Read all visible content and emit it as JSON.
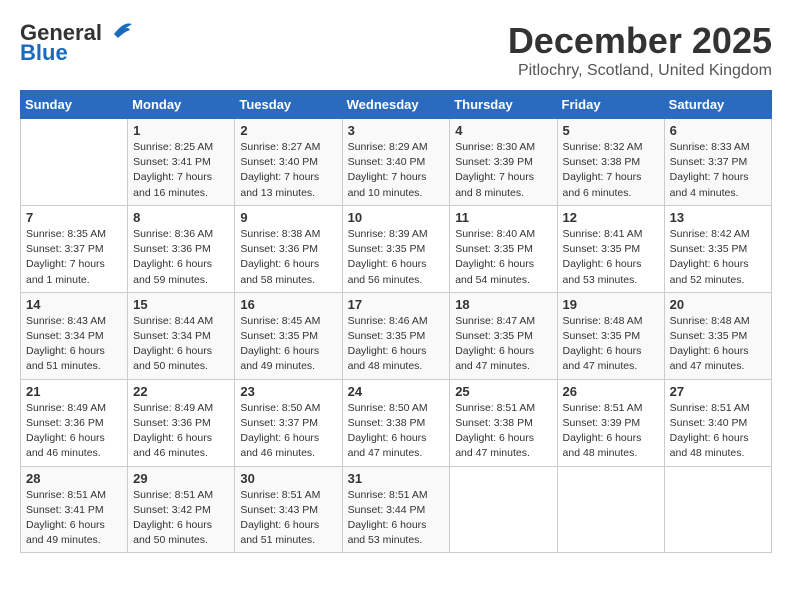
{
  "logo": {
    "general": "General",
    "blue": "Blue"
  },
  "title": "December 2025",
  "location": "Pitlochry, Scotland, United Kingdom",
  "days_of_week": [
    "Sunday",
    "Monday",
    "Tuesday",
    "Wednesday",
    "Thursday",
    "Friday",
    "Saturday"
  ],
  "weeks": [
    [
      {
        "day": "",
        "info": ""
      },
      {
        "day": "1",
        "info": "Sunrise: 8:25 AM\nSunset: 3:41 PM\nDaylight: 7 hours\nand 16 minutes."
      },
      {
        "day": "2",
        "info": "Sunrise: 8:27 AM\nSunset: 3:40 PM\nDaylight: 7 hours\nand 13 minutes."
      },
      {
        "day": "3",
        "info": "Sunrise: 8:29 AM\nSunset: 3:40 PM\nDaylight: 7 hours\nand 10 minutes."
      },
      {
        "day": "4",
        "info": "Sunrise: 8:30 AM\nSunset: 3:39 PM\nDaylight: 7 hours\nand 8 minutes."
      },
      {
        "day": "5",
        "info": "Sunrise: 8:32 AM\nSunset: 3:38 PM\nDaylight: 7 hours\nand 6 minutes."
      },
      {
        "day": "6",
        "info": "Sunrise: 8:33 AM\nSunset: 3:37 PM\nDaylight: 7 hours\nand 4 minutes."
      }
    ],
    [
      {
        "day": "7",
        "info": "Sunrise: 8:35 AM\nSunset: 3:37 PM\nDaylight: 7 hours\nand 1 minute."
      },
      {
        "day": "8",
        "info": "Sunrise: 8:36 AM\nSunset: 3:36 PM\nDaylight: 6 hours\nand 59 minutes."
      },
      {
        "day": "9",
        "info": "Sunrise: 8:38 AM\nSunset: 3:36 PM\nDaylight: 6 hours\nand 58 minutes."
      },
      {
        "day": "10",
        "info": "Sunrise: 8:39 AM\nSunset: 3:35 PM\nDaylight: 6 hours\nand 56 minutes."
      },
      {
        "day": "11",
        "info": "Sunrise: 8:40 AM\nSunset: 3:35 PM\nDaylight: 6 hours\nand 54 minutes."
      },
      {
        "day": "12",
        "info": "Sunrise: 8:41 AM\nSunset: 3:35 PM\nDaylight: 6 hours\nand 53 minutes."
      },
      {
        "day": "13",
        "info": "Sunrise: 8:42 AM\nSunset: 3:35 PM\nDaylight: 6 hours\nand 52 minutes."
      }
    ],
    [
      {
        "day": "14",
        "info": "Sunrise: 8:43 AM\nSunset: 3:34 PM\nDaylight: 6 hours\nand 51 minutes."
      },
      {
        "day": "15",
        "info": "Sunrise: 8:44 AM\nSunset: 3:34 PM\nDaylight: 6 hours\nand 50 minutes."
      },
      {
        "day": "16",
        "info": "Sunrise: 8:45 AM\nSunset: 3:35 PM\nDaylight: 6 hours\nand 49 minutes."
      },
      {
        "day": "17",
        "info": "Sunrise: 8:46 AM\nSunset: 3:35 PM\nDaylight: 6 hours\nand 48 minutes."
      },
      {
        "day": "18",
        "info": "Sunrise: 8:47 AM\nSunset: 3:35 PM\nDaylight: 6 hours\nand 47 minutes."
      },
      {
        "day": "19",
        "info": "Sunrise: 8:48 AM\nSunset: 3:35 PM\nDaylight: 6 hours\nand 47 minutes."
      },
      {
        "day": "20",
        "info": "Sunrise: 8:48 AM\nSunset: 3:35 PM\nDaylight: 6 hours\nand 47 minutes."
      }
    ],
    [
      {
        "day": "21",
        "info": "Sunrise: 8:49 AM\nSunset: 3:36 PM\nDaylight: 6 hours\nand 46 minutes."
      },
      {
        "day": "22",
        "info": "Sunrise: 8:49 AM\nSunset: 3:36 PM\nDaylight: 6 hours\nand 46 minutes."
      },
      {
        "day": "23",
        "info": "Sunrise: 8:50 AM\nSunset: 3:37 PM\nDaylight: 6 hours\nand 46 minutes."
      },
      {
        "day": "24",
        "info": "Sunrise: 8:50 AM\nSunset: 3:38 PM\nDaylight: 6 hours\nand 47 minutes."
      },
      {
        "day": "25",
        "info": "Sunrise: 8:51 AM\nSunset: 3:38 PM\nDaylight: 6 hours\nand 47 minutes."
      },
      {
        "day": "26",
        "info": "Sunrise: 8:51 AM\nSunset: 3:39 PM\nDaylight: 6 hours\nand 48 minutes."
      },
      {
        "day": "27",
        "info": "Sunrise: 8:51 AM\nSunset: 3:40 PM\nDaylight: 6 hours\nand 48 minutes."
      }
    ],
    [
      {
        "day": "28",
        "info": "Sunrise: 8:51 AM\nSunset: 3:41 PM\nDaylight: 6 hours\nand 49 minutes."
      },
      {
        "day": "29",
        "info": "Sunrise: 8:51 AM\nSunset: 3:42 PM\nDaylight: 6 hours\nand 50 minutes."
      },
      {
        "day": "30",
        "info": "Sunrise: 8:51 AM\nSunset: 3:43 PM\nDaylight: 6 hours\nand 51 minutes."
      },
      {
        "day": "31",
        "info": "Sunrise: 8:51 AM\nSunset: 3:44 PM\nDaylight: 6 hours\nand 53 minutes."
      },
      {
        "day": "",
        "info": ""
      },
      {
        "day": "",
        "info": ""
      },
      {
        "day": "",
        "info": ""
      }
    ]
  ]
}
